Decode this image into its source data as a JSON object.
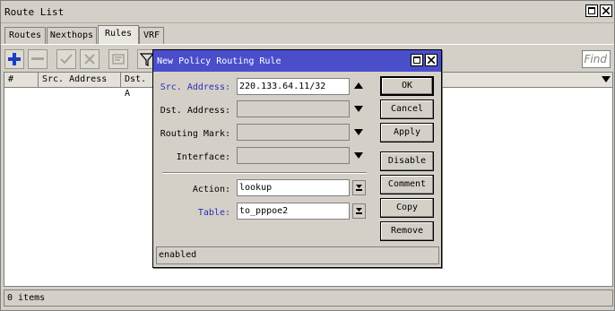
{
  "window": {
    "title": "Route List"
  },
  "tabs": [
    {
      "label": "Routes"
    },
    {
      "label": "Nexthops"
    },
    {
      "label": "Rules"
    },
    {
      "label": "VRF"
    }
  ],
  "active_tab": "Rules",
  "toolbar": {
    "find_placeholder": "Find"
  },
  "table": {
    "columns": [
      "#",
      "Src. Address",
      "Dst. A"
    ]
  },
  "status": {
    "count": "0 items"
  },
  "dialog": {
    "title": "New Policy Routing Rule",
    "fields": {
      "src_label": "Src. Address:",
      "src_value": "220.133.64.11/32",
      "dst_label": "Dst. Address:",
      "mark_label": "Routing Mark:",
      "iface_label": "Interface:",
      "action_label": "Action:",
      "action_value": "lookup",
      "table_label": "Table:",
      "table_value": "to_pppoe2"
    },
    "buttons": {
      "ok": "OK",
      "cancel": "Cancel",
      "apply": "Apply",
      "disable": "Disable",
      "comment": "Comment",
      "copy": "Copy",
      "remove": "Remove"
    },
    "status": "enabled"
  },
  "colors": {
    "dialog_title_bg": "#4a4ecb",
    "label_blue": "#2930b5",
    "add_icon": "#1a3fc2"
  }
}
